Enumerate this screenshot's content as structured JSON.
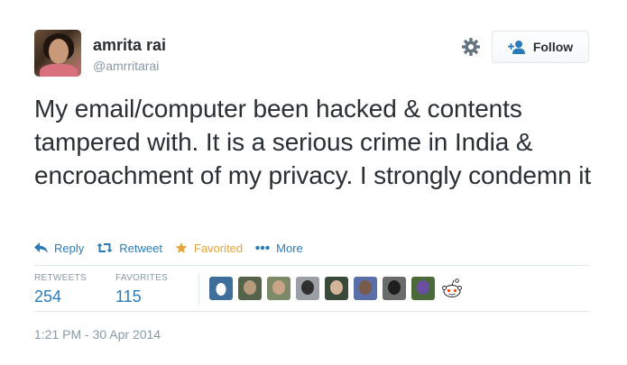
{
  "user": {
    "name": "amrita rai",
    "handle": "@amrritarai"
  },
  "follow_button": {
    "label": "Follow",
    "icon": "follow-user-icon"
  },
  "settings_icon": "gear-icon",
  "tweet": {
    "text": "My email/computer been hacked & contents tampered with. It is a serious crime in India & encroachment of my privacy. I strongly condemn it"
  },
  "actions": {
    "reply": "Reply",
    "retweet": "Retweet",
    "favorite": "Favorited",
    "more": "More"
  },
  "stats": {
    "retweets_label": "RETWEETS",
    "retweets_value": "254",
    "favorites_label": "FAVORITES",
    "favorites_value": "115"
  },
  "favoriters": [
    {
      "bg": "#3d6f9a",
      "fg": "#ffffff",
      "kind": "egg"
    },
    {
      "bg": "#55634a",
      "fg": "#b89a7c"
    },
    {
      "bg": "#7d8a6a",
      "fg": "#caa486"
    },
    {
      "bg": "#9aa0a6",
      "fg": "#2f2f2f"
    },
    {
      "bg": "#3a4a3a",
      "fg": "#d4b59a"
    },
    {
      "bg": "#5a6fa8",
      "fg": "#7a5a48"
    },
    {
      "bg": "#6b6b6b",
      "fg": "#1f1f1f"
    },
    {
      "bg": "#4a6a3a",
      "fg": "#6a4fa0"
    },
    {
      "bg": "#ffffff",
      "fg": "#ff4500",
      "kind": "reddit"
    }
  ],
  "timestamp": "1:21 PM - 30 Apr 2014",
  "colors": {
    "accent": "#2b7bb9",
    "favorited": "#e5a539",
    "muted": "#8899a6",
    "text": "#292f33"
  }
}
